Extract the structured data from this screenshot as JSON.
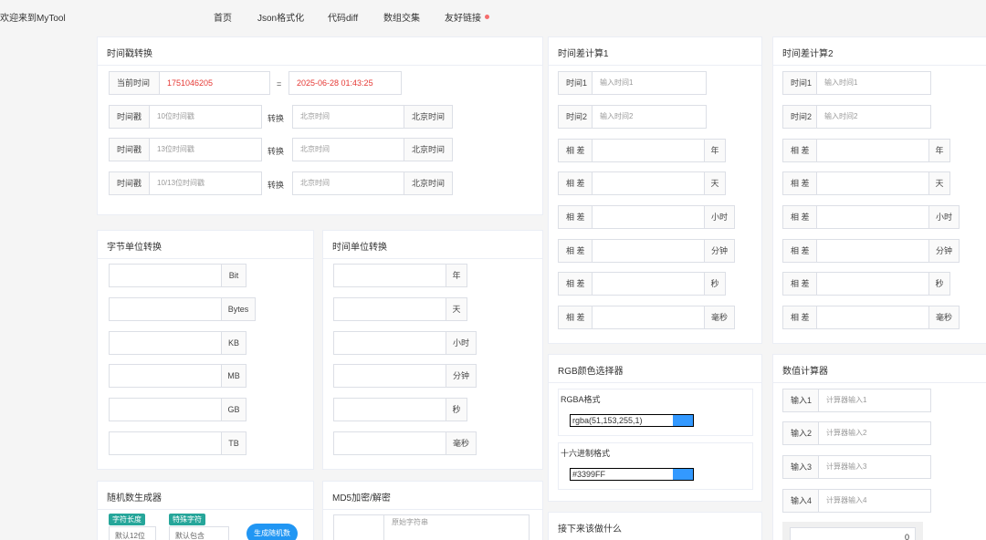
{
  "brand": "欢迎来到MyTool",
  "nav": [
    {
      "label": "首页"
    },
    {
      "label": "Json格式化"
    },
    {
      "label": "代码diff"
    },
    {
      "label": "数组交集"
    },
    {
      "label": "友好链接"
    }
  ],
  "timestamp": {
    "title": "时间戳转换",
    "now_label": "当前时间",
    "now_value": "1751046205",
    "equals": "=",
    "now_date": "2025-06-28 01:43:25",
    "rows": [
      {
        "label": "时间戳",
        "placeholder": "10位时间戳",
        "convert": "转换",
        "out_placeholder": "北京时间",
        "suffix": "北京时间"
      },
      {
        "label": "时间戳",
        "placeholder": "13位时间戳",
        "convert": "转换",
        "out_placeholder": "北京时间",
        "suffix": "北京时间"
      },
      {
        "label": "时间戳",
        "placeholder": "10/13位时间戳",
        "convert": "转换",
        "out_placeholder": "北京时间",
        "suffix": "北京时间"
      }
    ]
  },
  "timediff1": {
    "title": "时间差计算1",
    "t1_label": "时间1",
    "t1_placeholder": "输入时间1",
    "t2_label": "时间2",
    "t2_placeholder": "输入时间2",
    "diff_label": "相 差",
    "units": [
      "年",
      "天",
      "小时",
      "分钟",
      "秒",
      "毫秒"
    ]
  },
  "timediff2": {
    "title": "时间差计算2",
    "t1_label": "时间1",
    "t1_placeholder": "输入时间1",
    "t2_label": "时间2",
    "t2_placeholder": "输入时间2",
    "diff_label": "相 差",
    "units": [
      "年",
      "天",
      "小时",
      "分钟",
      "秒",
      "毫秒"
    ]
  },
  "bytes": {
    "title": "字节单位转换",
    "units": [
      "Bit",
      "Bytes",
      "KB",
      "MB",
      "GB",
      "TB"
    ]
  },
  "timeunits": {
    "title": "时间单位转换",
    "units": [
      "年",
      "天",
      "小时",
      "分钟",
      "秒",
      "毫秒"
    ]
  },
  "rgb": {
    "title": "RGB颜色选择器",
    "rgba_label": "RGBA格式",
    "rgba_value": "rgba(51,153,255,1)",
    "hex_label": "十六进制格式",
    "hex_value": "#3399FF",
    "color": "#3399ff"
  },
  "calc": {
    "title": "数值计算器",
    "inputs": [
      {
        "label": "输入1",
        "placeholder": "计算器输入1"
      },
      {
        "label": "输入2",
        "placeholder": "计算器输入2"
      },
      {
        "label": "输入3",
        "placeholder": "计算器输入3"
      },
      {
        "label": "输入4",
        "placeholder": "计算器输入4"
      }
    ],
    "result": "0"
  },
  "random": {
    "title": "随机数生成器",
    "tag_length": "字符长度",
    "tag_special": "特殊字符",
    "length_value": "默认12位",
    "special_value": "默认包含",
    "button": "生成随机数"
  },
  "md5": {
    "title": "MD5加密/解密",
    "placeholder": "原始字符串"
  },
  "todo": {
    "title": "接下来该做什么"
  }
}
